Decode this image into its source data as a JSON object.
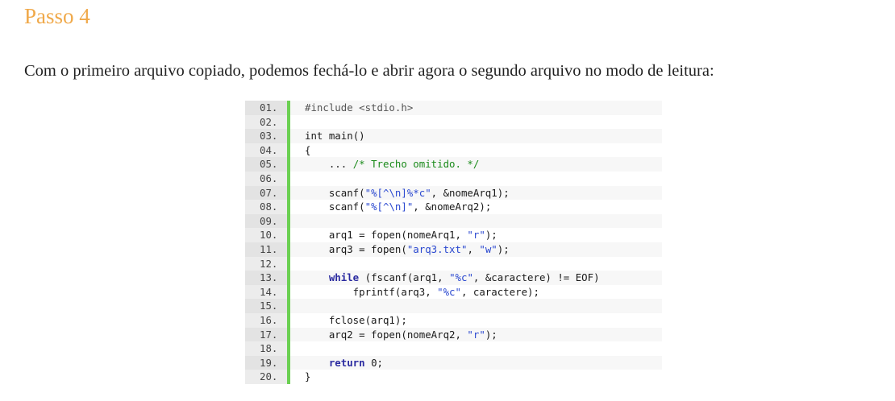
{
  "step_title": "Passo 4",
  "paragraph": "Com o primeiro arquivo copiado, podemos fechá-lo e abrir agora o segundo arquivo no modo de leitura:",
  "code": {
    "lines": [
      {
        "num": "01.",
        "tokens": [
          {
            "t": "pp",
            "v": "#include <stdio.h>"
          }
        ]
      },
      {
        "num": "02.",
        "tokens": []
      },
      {
        "num": "03.",
        "tokens": [
          {
            "t": "kw-plain",
            "v": "int"
          },
          {
            "t": "plain",
            "v": " main()"
          }
        ]
      },
      {
        "num": "04.",
        "tokens": [
          {
            "t": "plain",
            "v": "{"
          }
        ]
      },
      {
        "num": "05.",
        "tokens": [
          {
            "t": "plain",
            "v": "    ... "
          },
          {
            "t": "cm",
            "v": "/* Trecho omitido. */"
          }
        ]
      },
      {
        "num": "06.",
        "tokens": []
      },
      {
        "num": "07.",
        "tokens": [
          {
            "t": "plain",
            "v": "    scanf("
          },
          {
            "t": "str",
            "v": "\"%[^\\n]%*c\""
          },
          {
            "t": "plain",
            "v": ", &nomeArq1);"
          }
        ]
      },
      {
        "num": "08.",
        "tokens": [
          {
            "t": "plain",
            "v": "    scanf("
          },
          {
            "t": "str",
            "v": "\"%[^\\n]\""
          },
          {
            "t": "plain",
            "v": ", &nomeArq2);"
          }
        ]
      },
      {
        "num": "09.",
        "tokens": []
      },
      {
        "num": "10.",
        "tokens": [
          {
            "t": "plain",
            "v": "    arq1 = fopen(nomeArq1, "
          },
          {
            "t": "str",
            "v": "\"r\""
          },
          {
            "t": "plain",
            "v": ");"
          }
        ]
      },
      {
        "num": "11.",
        "tokens": [
          {
            "t": "plain",
            "v": "    arq3 = fopen("
          },
          {
            "t": "str",
            "v": "\"arq3.txt\""
          },
          {
            "t": "plain",
            "v": ", "
          },
          {
            "t": "str",
            "v": "\"w\""
          },
          {
            "t": "plain",
            "v": ");"
          }
        ]
      },
      {
        "num": "12.",
        "tokens": []
      },
      {
        "num": "13.",
        "tokens": [
          {
            "t": "plain",
            "v": "    "
          },
          {
            "t": "kw",
            "v": "while"
          },
          {
            "t": "plain",
            "v": " (fscanf(arq1, "
          },
          {
            "t": "str",
            "v": "\"%c\""
          },
          {
            "t": "plain",
            "v": ", &caractere) != EOF)"
          }
        ]
      },
      {
        "num": "14.",
        "tokens": [
          {
            "t": "plain",
            "v": "        fprintf(arq3, "
          },
          {
            "t": "str",
            "v": "\"%c\""
          },
          {
            "t": "plain",
            "v": ", caractere);"
          }
        ]
      },
      {
        "num": "15.",
        "tokens": []
      },
      {
        "num": "16.",
        "tokens": [
          {
            "t": "plain",
            "v": "    fclose(arq1);"
          }
        ]
      },
      {
        "num": "17.",
        "tokens": [
          {
            "t": "plain",
            "v": "    arq2 = fopen(nomeArq2, "
          },
          {
            "t": "str",
            "v": "\"r\""
          },
          {
            "t": "plain",
            "v": ");"
          }
        ]
      },
      {
        "num": "18.",
        "tokens": []
      },
      {
        "num": "19.",
        "tokens": [
          {
            "t": "plain",
            "v": "    "
          },
          {
            "t": "kw",
            "v": "return"
          },
          {
            "t": "plain",
            "v": " 0;"
          }
        ]
      },
      {
        "num": "20.",
        "tokens": [
          {
            "t": "plain",
            "v": "}"
          }
        ]
      }
    ]
  },
  "colors": {
    "title": "#f0a94a",
    "gutter_bar": "#6bd052",
    "keyword": "#2a2aa0",
    "string": "#2a48d0",
    "comment": "#1a8a1a"
  }
}
